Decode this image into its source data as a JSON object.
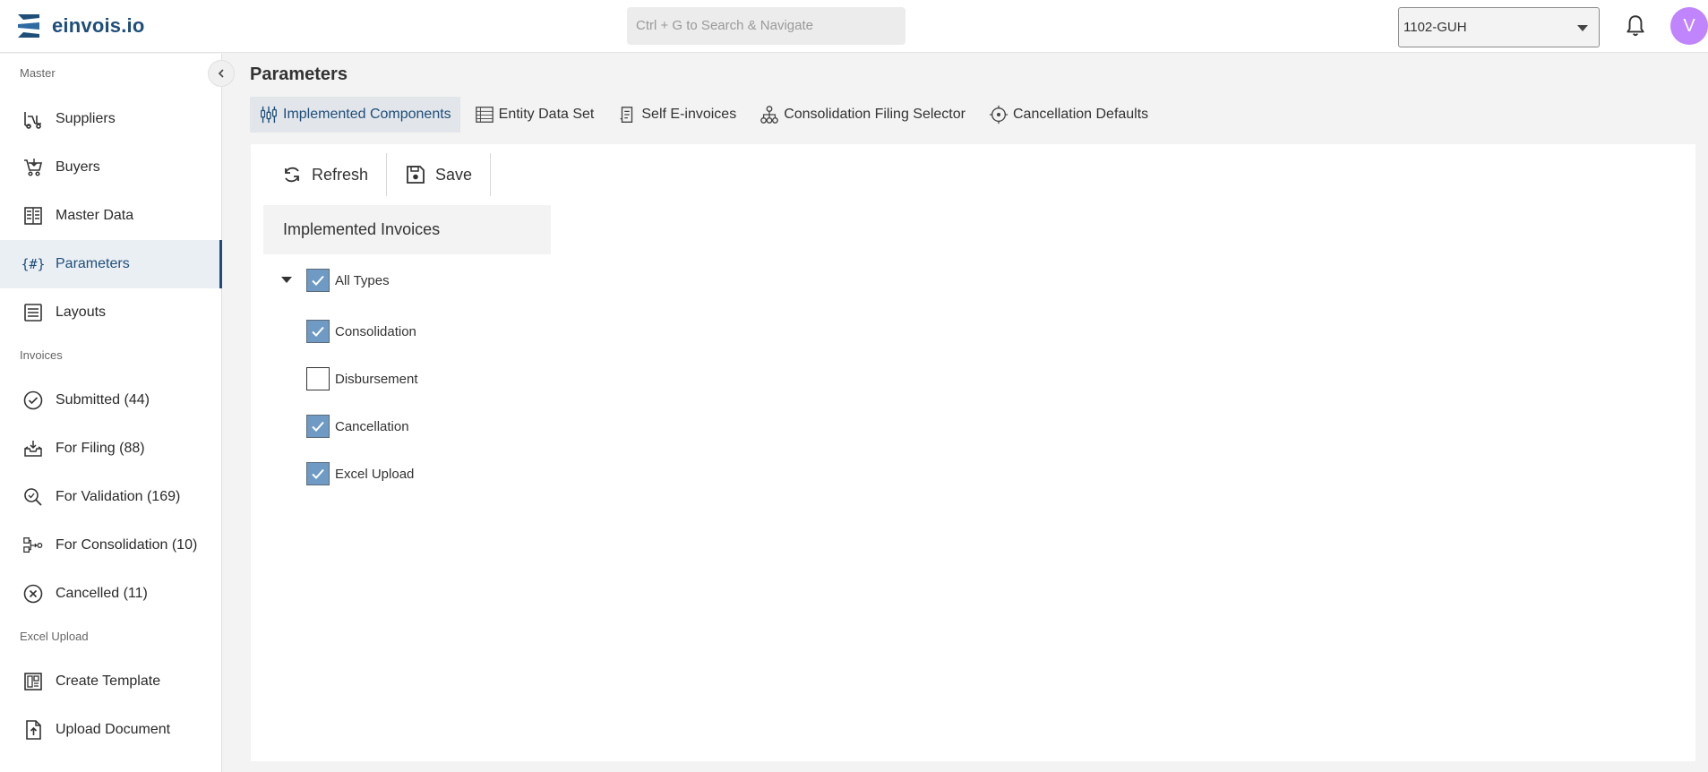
{
  "app": {
    "name": "einvois.io"
  },
  "search": {
    "placeholder": "Ctrl + G to Search & Navigate"
  },
  "org_select": {
    "value": "1102-GUH"
  },
  "user": {
    "initial": "V",
    "avatar_color": "#c084fc"
  },
  "sidebar": {
    "sections": [
      {
        "title": "Master",
        "items": [
          {
            "label": "Suppliers",
            "icon": "forklift-icon"
          },
          {
            "label": "Buyers",
            "icon": "cart-icon"
          },
          {
            "label": "Master Data",
            "icon": "ledger-icon"
          },
          {
            "label": "Parameters",
            "icon": "code-hash-icon",
            "active": true
          },
          {
            "label": "Layouts",
            "icon": "list-icon"
          }
        ]
      },
      {
        "title": "Invoices",
        "items": [
          {
            "label": "Submitted (44)",
            "icon": "check-circle-icon"
          },
          {
            "label": "For Filing (88)",
            "icon": "inbox-icon"
          },
          {
            "label": "For Validation (169)",
            "icon": "magnify-check-icon"
          },
          {
            "label": "For Consolidation (10)",
            "icon": "merge-icon"
          },
          {
            "label": "Cancelled (11)",
            "icon": "cancel-circle-icon"
          }
        ]
      },
      {
        "title": "Excel Upload",
        "items": [
          {
            "label": "Create Template",
            "icon": "template-icon"
          },
          {
            "label": "Upload Document",
            "icon": "file-upload-icon"
          }
        ]
      }
    ]
  },
  "page": {
    "title": "Parameters",
    "tabs": [
      {
        "label": "Implemented Components",
        "icon": "components-icon",
        "active": true
      },
      {
        "label": "Entity Data Set",
        "icon": "table-icon"
      },
      {
        "label": "Self E-invoices",
        "icon": "receipt-icon"
      },
      {
        "label": "Consolidation Filing Selector",
        "icon": "hierarchy-icon"
      },
      {
        "label": "Cancellation Defaults",
        "icon": "target-icon"
      }
    ],
    "toolbar": {
      "refresh_label": "Refresh",
      "save_label": "Save"
    },
    "section_title": "Implemented Invoices",
    "tree": {
      "root": {
        "label": "All Types",
        "checked": true,
        "expanded": true
      },
      "children": [
        {
          "label": "Consolidation",
          "checked": true
        },
        {
          "label": "Disbursement",
          "checked": false
        },
        {
          "label": "Cancellation",
          "checked": true
        },
        {
          "label": "Excel Upload",
          "checked": true
        }
      ]
    }
  },
  "colors": {
    "brand": "#1f4e79",
    "checkbox_checked": "#6f9ac4",
    "active_tab_bg": "#e2e6ea"
  }
}
